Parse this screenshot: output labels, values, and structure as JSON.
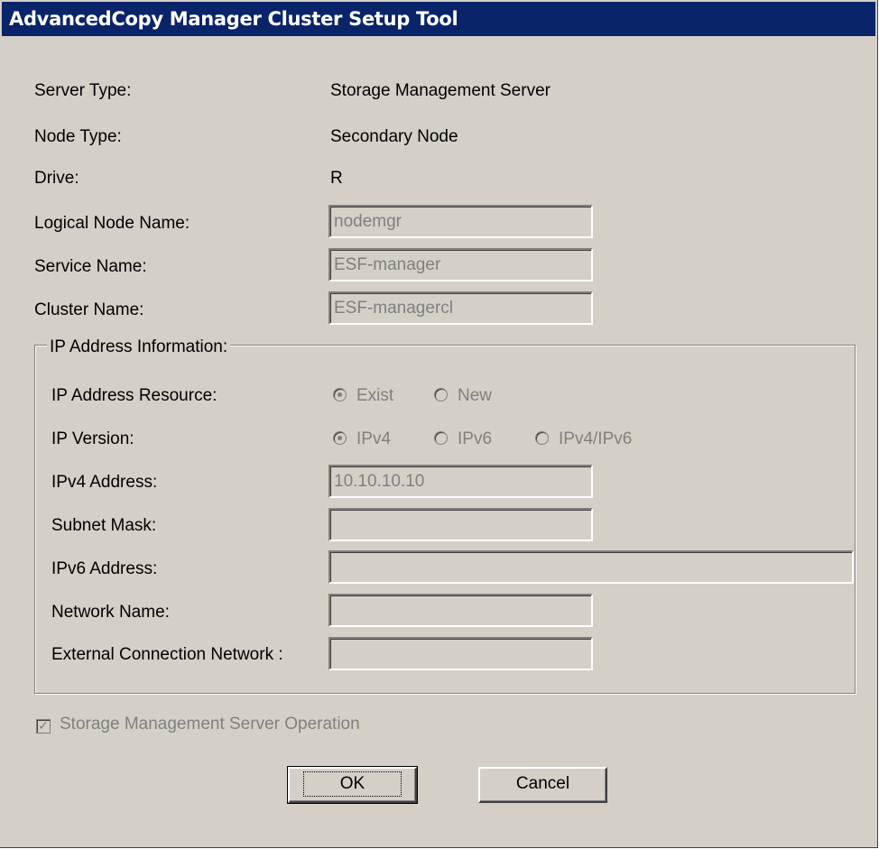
{
  "window": {
    "title": "AdvancedCopy Manager Cluster Setup Tool"
  },
  "info": [
    {
      "label": "Server Type:",
      "value": "Storage Management Server"
    },
    {
      "label": "Node Type:",
      "value": "Secondary Node"
    },
    {
      "label": "Drive:",
      "value": "R"
    }
  ],
  "fields": {
    "logical_node_name": {
      "label": "Logical Node Name:",
      "value": "nodemgr"
    },
    "service_name": {
      "label": "Service Name:",
      "value": "ESF-manager"
    },
    "cluster_name": {
      "label": "Cluster Name:",
      "value": "ESF-managercl"
    }
  },
  "ip_group": {
    "title": "IP Address Information:",
    "ip_address_resource": {
      "label": "IP Address Resource:",
      "options": [
        "Exist",
        "New"
      ],
      "selected": "Exist"
    },
    "ip_version": {
      "label": "IP Version:",
      "options": [
        "IPv4",
        "IPv6",
        "IPv4/IPv6"
      ],
      "selected": "IPv4"
    },
    "ipv4_address": {
      "label": "IPv4 Address:",
      "value": "10.10.10.10"
    },
    "subnet_mask": {
      "label": "Subnet Mask:",
      "value": ""
    },
    "ipv6_address": {
      "label": "IPv6 Address:",
      "value": ""
    },
    "network_name": {
      "label": "Network Name:",
      "value": ""
    },
    "external_connection_network": {
      "label": "External Connection Network :",
      "value": ""
    }
  },
  "checkbox": {
    "label": "Storage Management Server Operation",
    "checked": true
  },
  "buttons": {
    "ok": "OK",
    "cancel": "Cancel"
  },
  "colors": {
    "titlebar": "#0a246a",
    "face": "#d4d0c8",
    "disabled_text": "#808080"
  }
}
